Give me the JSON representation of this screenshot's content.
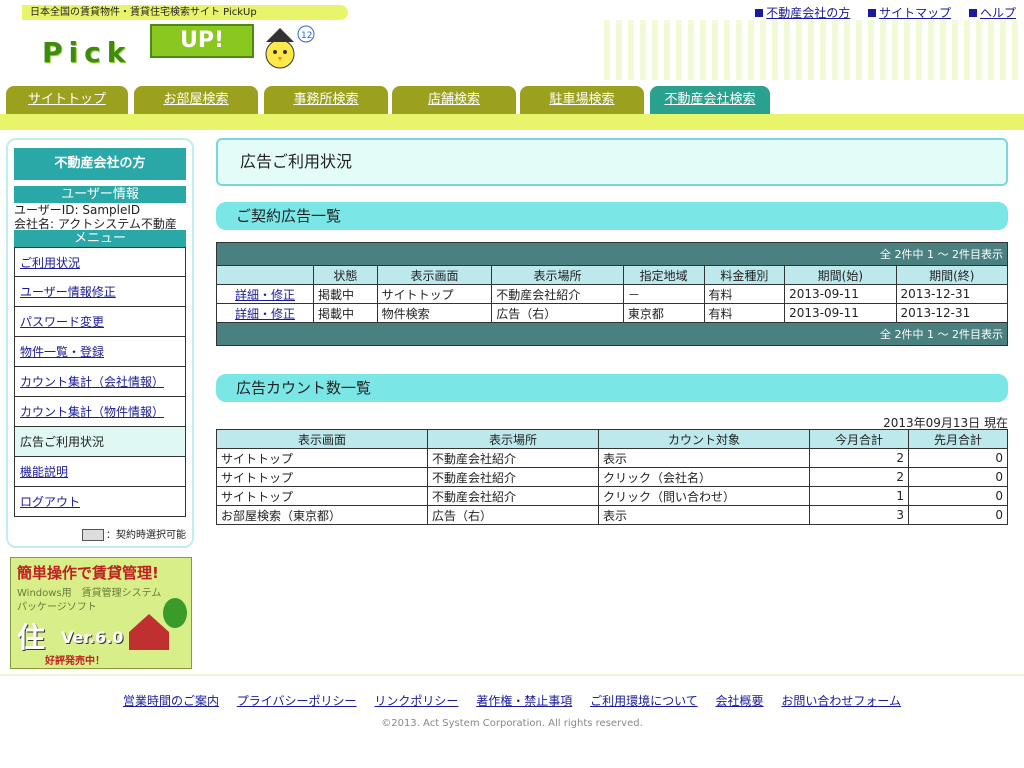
{
  "header": {
    "tagline": "日本全国の賃貸物件・賃貸住宅検索サイト PickUp",
    "logo_text": "Pick",
    "logo_up": "UP!",
    "top_links": [
      "不動産会社の方",
      "サイトマップ",
      "ヘルプ"
    ]
  },
  "tabs": [
    "サイトトップ",
    "お部屋検索",
    "事務所検索",
    "店舗検索",
    "駐車場検索",
    "不動産会社検索"
  ],
  "sidebar": {
    "heading": "不動産会社の方",
    "userinfo_heading": "ユーザー情報",
    "user_id": "ユーザーID: SampleID",
    "company": "会社名: アクトシステム不動産",
    "menu_heading": "メニュー",
    "menu": [
      "ご利用状況",
      "ユーザー情報修正",
      "パスワード変更",
      "物件一覧・登録",
      "カウント集計（会社情報）",
      "カウント集計（物件情報）",
      "広告ご利用状況",
      "機能説明",
      "ログアウト"
    ],
    "legend": "：契約時選択可能"
  },
  "banner": {
    "line1": "簡単操作で賃貸管理!",
    "line2": "Windows用　賃貸管理システム",
    "line3": "パッケージソフト",
    "kanji": "住",
    "version": "Ver.6.0",
    "line4": "好評発売中！"
  },
  "main": {
    "title": "広告ご利用状況",
    "contract_heading": "ご契約広告一覧",
    "contract_pager": "全 2件中 1 ～ 2件目表示",
    "contract_headers": [
      "",
      "状態",
      "表示画面",
      "表示場所",
      "指定地域",
      "料金種別",
      "期間(始)",
      "期間(終)"
    ],
    "contract_rows": [
      [
        "詳細・修正",
        "掲載中",
        "サイトトップ",
        "不動産会社紹介",
        "－",
        "有料",
        "2013-09-11",
        "2013-12-31"
      ],
      [
        "詳細・修正",
        "掲載中",
        "物件検索",
        "広告（右）",
        "東京都",
        "有料",
        "2013-09-11",
        "2013-12-31"
      ]
    ],
    "count_heading": "広告カウント数一覧",
    "as_of": "2013年09月13日 現在",
    "count_headers": [
      "表示画面",
      "表示場所",
      "カウント対象",
      "今月合計",
      "先月合計"
    ],
    "count_rows": [
      [
        "サイトトップ",
        "不動産会社紹介",
        "表示",
        "2",
        "0"
      ],
      [
        "サイトトップ",
        "不動産会社紹介",
        "クリック（会社名）",
        "2",
        "0"
      ],
      [
        "サイトトップ",
        "不動産会社紹介",
        "クリック（問い合わせ）",
        "1",
        "0"
      ],
      [
        "お部屋検索（東京都）",
        "広告（右）",
        "表示",
        "3",
        "0"
      ]
    ]
  },
  "footer": {
    "links": [
      "営業時間のご案内",
      "プライバシーポリシー",
      "リンクポリシー",
      "著作権・禁止事項",
      "ご利用環境について",
      "会社概要",
      "お問い合わせフォーム"
    ],
    "copyright": "©2013. Act System Corporation. All rights reserved."
  }
}
